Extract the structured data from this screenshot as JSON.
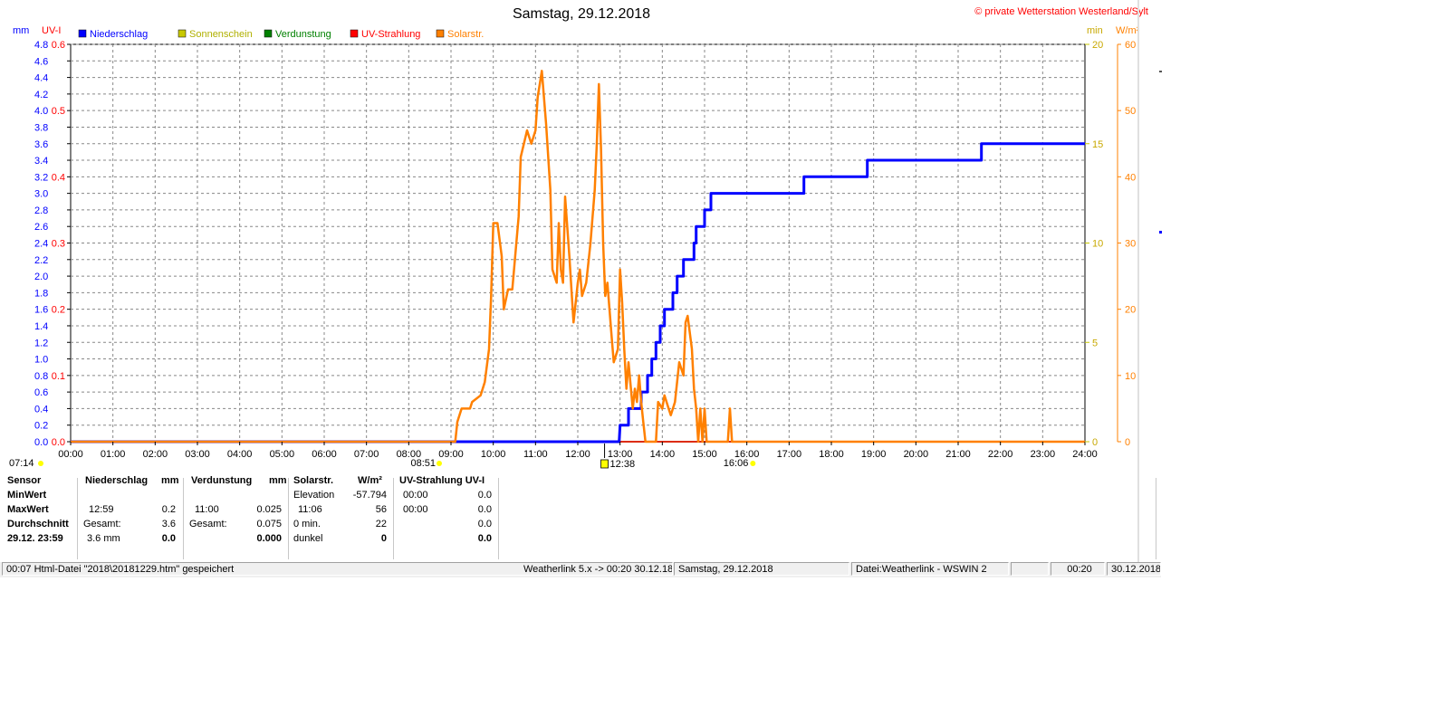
{
  "header": {
    "title": "Samstag, 29.12.2018",
    "copyright": "© private Wetterstation Westerland/Sylt"
  },
  "axes": {
    "left_mm_label": "mm",
    "left_uv_label": "UV-I",
    "right_min_label": "min",
    "right_wm2_label": "W/m²",
    "mm_ticks": [
      "0.0",
      "0.2",
      "0.4",
      "0.6",
      "0.8",
      "1.0",
      "1.2",
      "1.4",
      "1.6",
      "1.8",
      "2.0",
      "2.2",
      "2.4",
      "2.6",
      "2.8",
      "3.0",
      "3.2",
      "3.4",
      "3.6",
      "3.8",
      "4.0",
      "4.2",
      "4.4",
      "4.6",
      "4.8"
    ],
    "uv_ticks": [
      "0.0",
      "0.1",
      "0.2",
      "0.3",
      "0.4",
      "0.5",
      "0.6"
    ],
    "min_ticks": [
      "0",
      "5",
      "10",
      "15",
      "20"
    ],
    "wm2_ticks": [
      "0",
      "10",
      "20",
      "30",
      "40",
      "50",
      "60"
    ],
    "time_ticks": [
      "00:00",
      "01:00",
      "02:00",
      "03:00",
      "04:00",
      "05:00",
      "06:00",
      "07:00",
      "08:00",
      "09:00",
      "10:00",
      "11:00",
      "12:00",
      "13:00",
      "14:00",
      "15:00",
      "16:00",
      "17:00",
      "18:00",
      "19:00",
      "20:00",
      "21:00",
      "22:00",
      "23:00",
      "24:00"
    ]
  },
  "legend": [
    {
      "label": "Niederschlag",
      "color": "#0000ff"
    },
    {
      "label": "Sonnenschein",
      "color": "#c8c800"
    },
    {
      "label": "Verdunstung",
      "color": "#008000"
    },
    {
      "label": "UV-Strahlung",
      "color": "#ff0000"
    },
    {
      "label": "Solarstr.",
      "color": "#ff8000"
    }
  ],
  "markers": {
    "sunrise": "07:14",
    "sunshine_start": "08:51",
    "noon": "12:38",
    "sunset": "16:06"
  },
  "chart_data": {
    "type": "line",
    "xlim": [
      0,
      24
    ],
    "ylim_mm": [
      0,
      4.8
    ],
    "ylim_uv": [
      0,
      0.6
    ],
    "ylim_min": [
      0,
      20
    ],
    "ylim_wm2": [
      0,
      60
    ],
    "grid": true,
    "series": [
      {
        "name": "Niederschlag",
        "unit": "mm",
        "color": "#0000ff",
        "points": [
          [
            0,
            0
          ],
          [
            12.98,
            0
          ],
          [
            13.0,
            0.2
          ],
          [
            13.2,
            0.2
          ],
          [
            13.2,
            0.4
          ],
          [
            13.5,
            0.4
          ],
          [
            13.5,
            0.6
          ],
          [
            13.65,
            0.6
          ],
          [
            13.65,
            0.8
          ],
          [
            13.75,
            0.8
          ],
          [
            13.75,
            1.0
          ],
          [
            13.85,
            1.0
          ],
          [
            13.85,
            1.2
          ],
          [
            13.95,
            1.2
          ],
          [
            13.95,
            1.4
          ],
          [
            14.05,
            1.4
          ],
          [
            14.05,
            1.6
          ],
          [
            14.25,
            1.6
          ],
          [
            14.25,
            1.8
          ],
          [
            14.35,
            1.8
          ],
          [
            14.35,
            2.0
          ],
          [
            14.5,
            2.0
          ],
          [
            14.5,
            2.2
          ],
          [
            14.75,
            2.2
          ],
          [
            14.75,
            2.4
          ],
          [
            14.8,
            2.4
          ],
          [
            14.8,
            2.6
          ],
          [
            15.0,
            2.6
          ],
          [
            15.0,
            2.8
          ],
          [
            15.15,
            2.8
          ],
          [
            15.15,
            3.0
          ],
          [
            17.35,
            3.0
          ],
          [
            17.35,
            3.2
          ],
          [
            18.85,
            3.2
          ],
          [
            18.85,
            3.4
          ],
          [
            21.55,
            3.4
          ],
          [
            21.55,
            3.6
          ],
          [
            24,
            3.6
          ]
        ]
      },
      {
        "name": "Sonnenschein",
        "unit": "min",
        "color": "#c8c800",
        "points": [
          [
            0,
            0
          ],
          [
            24,
            0
          ]
        ]
      },
      {
        "name": "Verdunstung",
        "unit": "mm",
        "color": "#008000",
        "points": [
          [
            0,
            0
          ],
          [
            24,
            0
          ]
        ]
      },
      {
        "name": "UV-Strahlung",
        "unit": "UV-I",
        "color": "#ff0000",
        "points": [
          [
            0,
            0
          ],
          [
            24,
            0
          ]
        ]
      },
      {
        "name": "Solarstr.",
        "unit": "W/m²",
        "color": "#ff8000",
        "points": [
          [
            0,
            0
          ],
          [
            9.1,
            0
          ],
          [
            9.15,
            3
          ],
          [
            9.25,
            5
          ],
          [
            9.45,
            5
          ],
          [
            9.5,
            6
          ],
          [
            9.7,
            7
          ],
          [
            9.8,
            9
          ],
          [
            9.9,
            14
          ],
          [
            9.95,
            22
          ],
          [
            10.0,
            33
          ],
          [
            10.1,
            33
          ],
          [
            10.2,
            28
          ],
          [
            10.25,
            20
          ],
          [
            10.35,
            23
          ],
          [
            10.45,
            23
          ],
          [
            10.6,
            34
          ],
          [
            10.65,
            43
          ],
          [
            10.8,
            47
          ],
          [
            10.9,
            45
          ],
          [
            11.0,
            47
          ],
          [
            11.05,
            52
          ],
          [
            11.15,
            56
          ],
          [
            11.25,
            48
          ],
          [
            11.35,
            38
          ],
          [
            11.4,
            26
          ],
          [
            11.5,
            24
          ],
          [
            11.55,
            33
          ],
          [
            11.6,
            26
          ],
          [
            11.65,
            24
          ],
          [
            11.7,
            37
          ],
          [
            11.8,
            28
          ],
          [
            11.9,
            18
          ],
          [
            12.0,
            24
          ],
          [
            12.05,
            26
          ],
          [
            12.1,
            22
          ],
          [
            12.2,
            24
          ],
          [
            12.25,
            27
          ],
          [
            12.3,
            30
          ],
          [
            12.4,
            38
          ],
          [
            12.45,
            45
          ],
          [
            12.5,
            54
          ],
          [
            12.55,
            44
          ],
          [
            12.6,
            30
          ],
          [
            12.65,
            22
          ],
          [
            12.7,
            24
          ],
          [
            12.8,
            16
          ],
          [
            12.85,
            12
          ],
          [
            12.95,
            14
          ],
          [
            13.0,
            26
          ],
          [
            13.05,
            21
          ],
          [
            13.1,
            14
          ],
          [
            13.15,
            8
          ],
          [
            13.2,
            12
          ],
          [
            13.3,
            5
          ],
          [
            13.35,
            8
          ],
          [
            13.4,
            6
          ],
          [
            13.45,
            10
          ],
          [
            13.5,
            6
          ],
          [
            13.55,
            3
          ],
          [
            13.6,
            0
          ],
          [
            13.85,
            0
          ],
          [
            13.9,
            6
          ],
          [
            14.0,
            5
          ],
          [
            14.05,
            7
          ],
          [
            14.15,
            5
          ],
          [
            14.2,
            4
          ],
          [
            14.3,
            6
          ],
          [
            14.4,
            12
          ],
          [
            14.5,
            10
          ],
          [
            14.55,
            18
          ],
          [
            14.6,
            19
          ],
          [
            14.7,
            14
          ],
          [
            14.75,
            8
          ],
          [
            14.8,
            5
          ],
          [
            14.85,
            0
          ],
          [
            14.9,
            5
          ],
          [
            14.95,
            0
          ],
          [
            15.0,
            5
          ],
          [
            15.05,
            0
          ],
          [
            15.1,
            0
          ],
          [
            15.55,
            0
          ],
          [
            15.6,
            5
          ],
          [
            15.65,
            0
          ],
          [
            24,
            0
          ]
        ]
      }
    ]
  },
  "stats": {
    "sensor_col": {
      "header": "Sensor",
      "min": "MinWert",
      "max": "MaxWert",
      "avg": "Durchschnitt",
      "date": "29.12.  23:59"
    },
    "niederschlag": {
      "header": "Niederschlag",
      "unit": "mm",
      "max_time": "12:59",
      "max_value": "0.2",
      "total_label": "Gesamt:",
      "total_value": "3.6",
      "bottom_value": "3.6 mm",
      "bottom_bold": "0.0"
    },
    "verdunstung": {
      "header": "Verdunstung",
      "unit": "mm",
      "max_time": "11:00",
      "max_value": "0.025",
      "total_label": "Gesamt:",
      "total_value": "0.075",
      "bottom_bold": "0.000"
    },
    "solar": {
      "header": "Solarstr.",
      "unit": "W/m²",
      "elev_label": "Elevation",
      "elev_value": "-57.794",
      "max_time": "11:06",
      "max_value": "56",
      "zero_label": "0 min.",
      "zero_value": "22",
      "dark_label": "dunkel",
      "dark_value": "0"
    },
    "uv": {
      "header": "UV-Strahlung UV-I",
      "min_time": "00:00",
      "min_value": "0.0",
      "max_time": "00:00",
      "max_value": "0.0",
      "avg_value": "0.0",
      "bottom_bold": "0.0"
    }
  },
  "statusbar": {
    "cell1": "00:07  Html-Datei  \"2018\\20181229.htm\"  gespeichert",
    "cell1_right": "Weatherlink 5.x -> 00:20  30.12.18",
    "cell2": "Samstag, 29.12.2018",
    "cell3": "Datei:Weatherlink - WSWIN 2",
    "cell4": "",
    "cell5": "00:20",
    "cell6": "30.12.2018"
  }
}
